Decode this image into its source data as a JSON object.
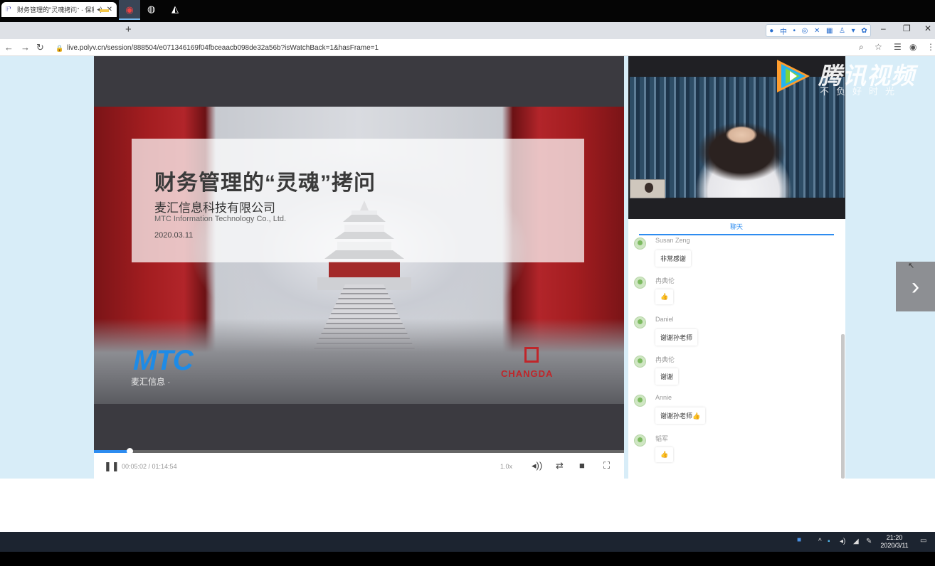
{
  "browser": {
    "tab_title": "财务管理的\"灵魂拷问\" - 保利",
    "tab_favicon": "P",
    "tab_audio_icon": "speaker-icon",
    "new_tab": "+",
    "url": "live.polyv.cn/session/888504/e071346169f04fbceaacb098de32a56b?isWatchBack=1&hasFrame=1",
    "extension_glyphs": [
      "●",
      "中",
      "•",
      "◎",
      "✕",
      "▦",
      "♙",
      "▾",
      "✿"
    ],
    "window_controls": [
      "–",
      "❐",
      "✕"
    ]
  },
  "slide": {
    "title": "财务管理的“灵魂”拷问",
    "company_cn": "麦汇信息科技有限公司",
    "company_en": "MTC Information Technology Co., Ltd.",
    "date": "2020.03.11",
    "logo": "MTC",
    "logo_sub": "麦汇信息 ·",
    "logo2": "CHANGDA"
  },
  "player": {
    "progress": 0.067,
    "time": "00:05:02 / 01:14:54",
    "speed": "1.0x",
    "pause_icon": "❚❚"
  },
  "watermark": {
    "brand": "腾讯视频",
    "slogan": "不负好时光"
  },
  "chat": {
    "tab_label": "聊天",
    "messages": [
      {
        "name": "Susan Zeng",
        "text": "非常感谢"
      },
      {
        "name": "冉典伦",
        "text": "👍"
      },
      {
        "name": "Daniel",
        "text": "谢谢孙老师"
      },
      {
        "name": "冉典伦",
        "text": "谢谢"
      },
      {
        "name": "Annie",
        "text": "谢谢孙老师👍"
      },
      {
        "name": "韬军",
        "text": "👍"
      }
    ]
  },
  "taskbar": {
    "clock_time": "21:20",
    "clock_date": "2020/3/11"
  },
  "colors": {
    "accent": "#2d8cf0",
    "page_bg": "#d8edf8",
    "player_bg": "#3b3a40",
    "mtc_blue": "#1e8be6",
    "changda_red": "#c0262a"
  }
}
